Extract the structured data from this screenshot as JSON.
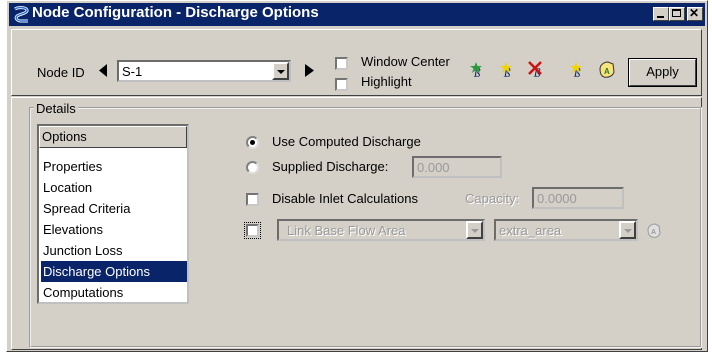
{
  "window": {
    "title": "Node Configuration - Discharge Options"
  },
  "toolbar": {
    "node_id_label": "Node ID",
    "node_id_value": "S-1",
    "window_center_label": "Window Center",
    "highlight_label": "Highlight",
    "apply_label": "Apply",
    "tool_icons": [
      "add-node-icon",
      "edit-node-icon",
      "delete-node-icon",
      "add-node-icon",
      "node-label-icon"
    ]
  },
  "details": {
    "group_label": "Details",
    "options_header": "Options",
    "options": [
      "Properties",
      "Location",
      "Spread Criteria",
      "Elevations",
      "Junction Loss",
      "Discharge Options",
      "Computations"
    ],
    "selected_option": "Discharge Options",
    "use_computed_label": "Use Computed Discharge",
    "supplied_label": "Supplied Discharge:",
    "supplied_value": "0.000",
    "disable_inlet_label": "Disable Inlet Calculations",
    "capacity_label": "Capacity:",
    "capacity_value": "0.0000",
    "link_dropdown_value": "Link Base Flow Area",
    "area_dropdown_value": "extra_area"
  },
  "colors": {
    "title_bar": "#0a246a",
    "dialog_bg": "#d4d0c8",
    "selection": "#0a246a"
  }
}
